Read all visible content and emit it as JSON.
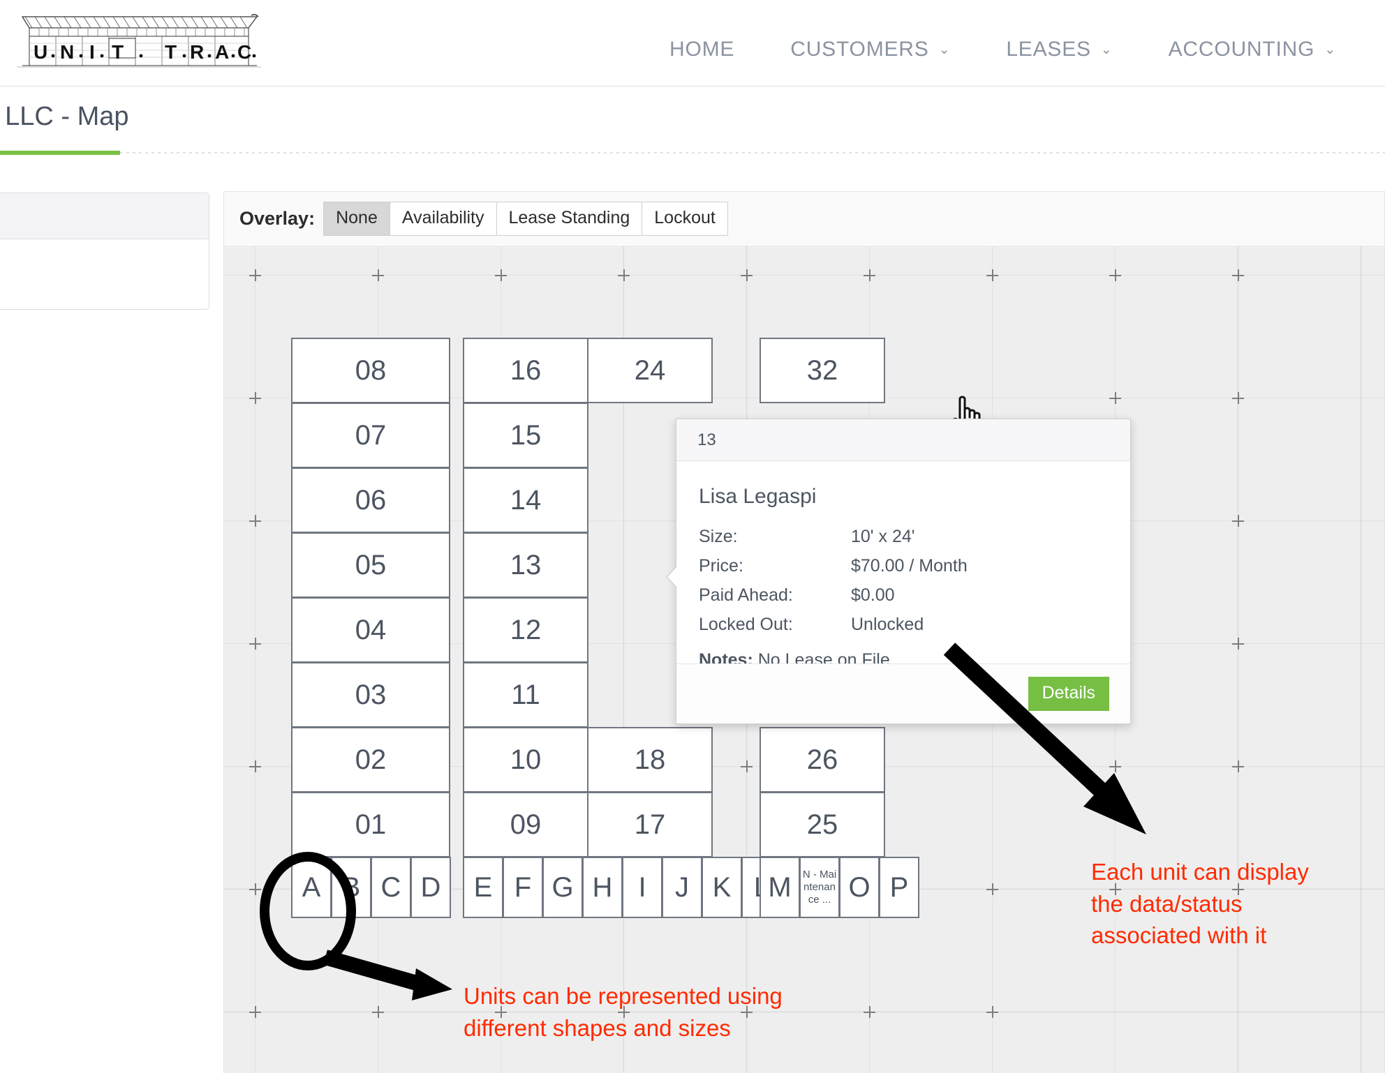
{
  "brand": {
    "logo_text": "U·N·I·T T·R·A·C",
    "logo_letters": [
      "U",
      "N",
      "I",
      "T",
      "T",
      "R",
      "A",
      "C"
    ]
  },
  "nav": {
    "items": [
      {
        "label": "HOME",
        "has_caret": false
      },
      {
        "label": "CUSTOMERS",
        "has_caret": true
      },
      {
        "label": "LEASES",
        "has_caret": true
      },
      {
        "label": "ACCOUNTING",
        "has_caret": true
      }
    ],
    "caret_glyph": "⌄"
  },
  "page": {
    "title": ", LLC - Map",
    "accent_color": "#7ac143"
  },
  "toolbar": {
    "overlay_label": "Overlay:",
    "buttons": [
      {
        "label": "None",
        "active": true
      },
      {
        "label": "Availability",
        "active": false
      },
      {
        "label": "Lease Standing",
        "active": false
      },
      {
        "label": "Lockout",
        "active": false
      }
    ]
  },
  "map": {
    "background_color": "#eeeeee",
    "unit_border_color": "#6f7681",
    "blocks": [
      {
        "name": "block-a",
        "units": [
          "08",
          "07",
          "06",
          "05",
          "04",
          "03",
          "02",
          "01"
        ],
        "letters": [
          "A",
          "B",
          "C",
          "D"
        ]
      },
      {
        "name": "block-b",
        "units": [
          "16",
          "15",
          "14",
          "13",
          "12",
          "11",
          "10",
          "09"
        ],
        "units_right": [
          "24",
          "",
          "",
          "",
          "",
          "",
          "18",
          "17"
        ],
        "letters": [
          "E",
          "F",
          "G",
          "H",
          "I",
          "J",
          "K",
          "L"
        ]
      },
      {
        "name": "block-c",
        "units": [
          "32",
          "",
          "",
          "",
          "",
          "",
          "26",
          "25"
        ],
        "letters": [
          "M",
          "N - Maintenance ...",
          "O",
          "P"
        ]
      }
    ]
  },
  "popup": {
    "header": "13",
    "customer_name": "Lisa Legaspi",
    "rows": [
      {
        "key": "Size:",
        "value": "10' x 24'"
      },
      {
        "key": "Price:",
        "value": "$70.00 / Month"
      },
      {
        "key": "Paid Ahead:",
        "value": "$0.00"
      },
      {
        "key": "Locked Out:",
        "value": "Unlocked"
      }
    ],
    "notes_label": "Notes:",
    "notes_value": "No Lease on File",
    "details_label": "Details",
    "details_color": "#76bf43"
  },
  "annotations": {
    "color": "#ff2a00",
    "right": "Each unit can display\nthe data/status\nassociated with it",
    "bottom": "Units can be represented using\ndifferent shapes and sizes"
  }
}
